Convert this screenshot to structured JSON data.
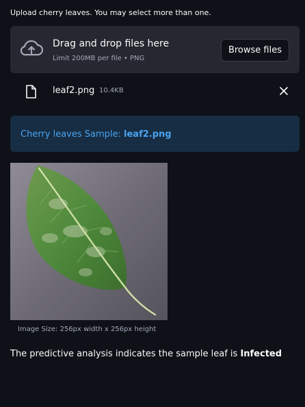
{
  "uploader": {
    "label": "Upload cherry leaves. You may select more than one.",
    "drop_title": "Drag and drop files here",
    "limit_text": "Limit 200MB per file • PNG",
    "browse_label": "Browse files"
  },
  "uploaded_file": {
    "name": "leaf2.png",
    "size": "10.4KB"
  },
  "info": {
    "prefix": "Cherry leaves Sample: ",
    "filename": "leaf2.png"
  },
  "image": {
    "caption": "Image Size: 256px width x 256px height"
  },
  "prediction": {
    "prefix": "The predictive analysis indicates the sample leaf is ",
    "result": "Infected"
  },
  "colors": {
    "background": "#0e1117",
    "dropzone": "#262730",
    "info_background": "#172d43",
    "info_text": "#4aa3f0"
  }
}
